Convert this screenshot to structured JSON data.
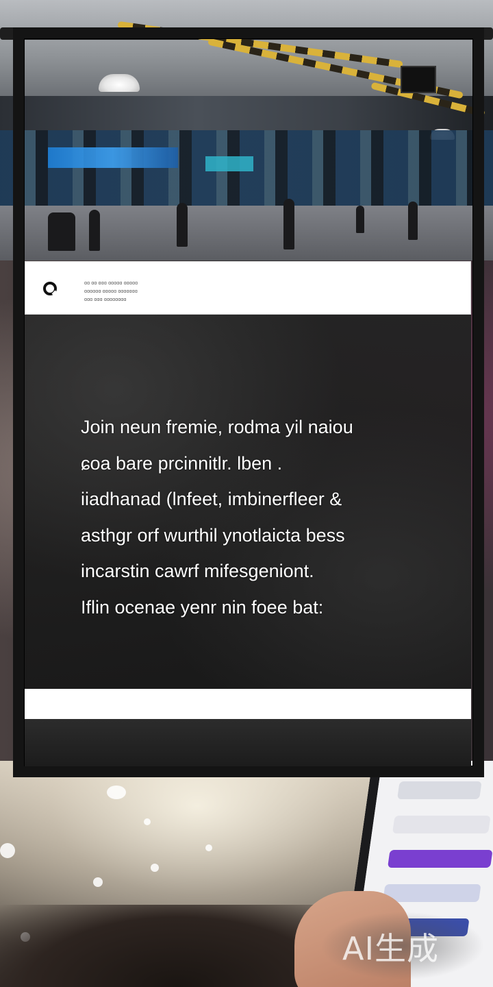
{
  "header": {
    "logo_icon": "circle-logo-icon",
    "small_lines": [
      "ɑɑ ɑɑ ɑɑɑ ɑɑɑɑɑ ɑɑɑɑɑ",
      "ɑɑɑɑɑɑ ɑɑɑɑɑ ɑɑɑɑɑɑɑ",
      "ɑɑɑ ɑɑɑ ɑɑɑɑɑɑɑɑ"
    ]
  },
  "body": {
    "lines": [
      "Join neun fremie,  rodma yil naiou",
      "ɕoa bare prcinnitlr. lben  .",
      "iiadhanad (lnfeet, imbinerfleer  &",
      "asthgr orf wurthil ynotlaicta  bess",
      "incarstin cawrf mifesgeniont.",
      "Iflin ocenae yenr nin foee bat:"
    ]
  },
  "watermark": {
    "text": "AI生成"
  },
  "colors": {
    "frame": "#141414",
    "header_bg": "#ffffff",
    "panel_bg": "#222222",
    "text": "#ffffff"
  }
}
